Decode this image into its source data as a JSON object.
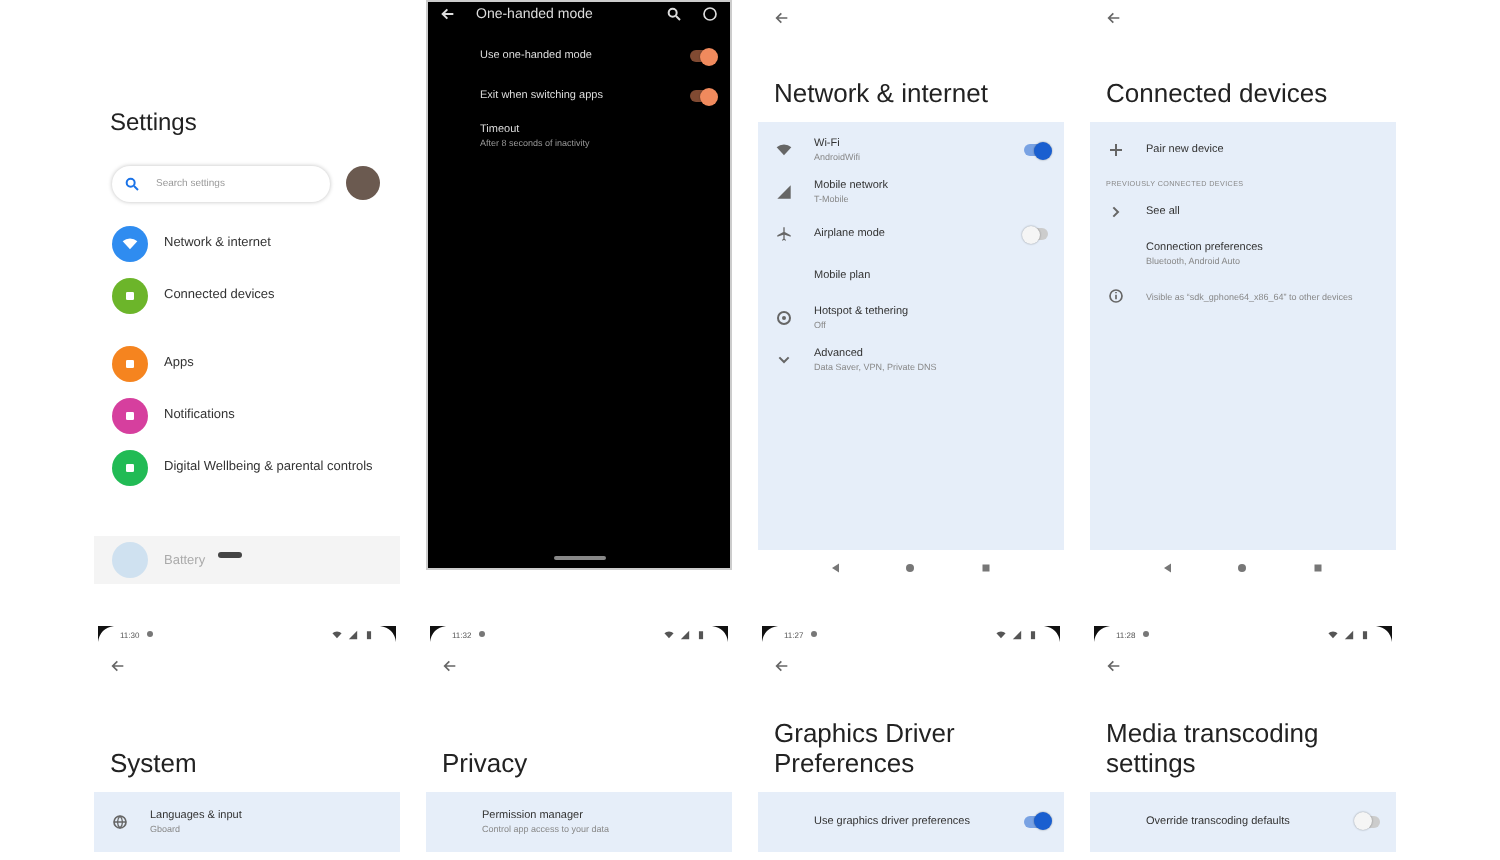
{
  "screens": [
    {
      "kind": "home",
      "title": "Settings",
      "search": {
        "placeholder": "Search settings"
      },
      "groups": [
        [
          {
            "label": "Network & internet",
            "color": "#2f8cf0"
          },
          {
            "label": "Connected devices",
            "color": "#6cb52a"
          }
        ],
        [
          {
            "label": "Apps",
            "color": "#f5841f"
          },
          {
            "label": "Notifications",
            "color": "#d63f9e"
          },
          {
            "label": "Digital Wellbeing & parental controls",
            "color": "#22bb55"
          }
        ]
      ],
      "peek": {
        "label": "Battery",
        "color": "#cfe1f0"
      }
    },
    {
      "kind": "dark",
      "title": "One-handed mode",
      "rows": [
        {
          "kind": "switch",
          "label": "Use one-handed mode",
          "on": true
        },
        {
          "kind": "switch",
          "label": "Exit when switching apps",
          "on": true
        },
        {
          "kind": "text",
          "label": "Timeout",
          "summary": "After 8 seconds of inactivity"
        }
      ]
    },
    {
      "kind": "list",
      "title": "Network & internet",
      "rows": [
        {
          "kind": "switch",
          "label": "Wi-Fi",
          "summary": "AndroidWifi",
          "on": true
        },
        {
          "kind": "text",
          "label": "Mobile network",
          "summary": "T-Mobile"
        },
        {
          "kind": "switch",
          "label": "Airplane mode",
          "on": false
        },
        {
          "kind": "text",
          "label": "Mobile plan"
        },
        {
          "kind": "text",
          "label": "Hotspot & tethering",
          "summary": "Off"
        },
        {
          "kind": "text",
          "label": "Advanced",
          "summary": "Data Saver, VPN, Private DNS"
        }
      ]
    },
    {
      "kind": "list",
      "title": "Connected devices",
      "rows": [
        {
          "kind": "text",
          "label": "Pair new device"
        },
        {
          "kind": "header",
          "label": "PREVIOUSLY CONNECTED DEVICES"
        },
        {
          "kind": "text",
          "label": "See all"
        },
        {
          "kind": "text",
          "label": "Connection preferences",
          "summary": "Bluetooth, Android Auto"
        },
        {
          "kind": "info",
          "label": "Visible as “sdk_gphone64_x86_64” to other devices"
        }
      ]
    },
    {
      "kind": "list",
      "time": "11:30",
      "title": "System",
      "rows": [
        {
          "kind": "text",
          "label": "Languages & input",
          "summary": "Gboard"
        }
      ]
    },
    {
      "kind": "list",
      "time": "11:32",
      "title": "Privacy",
      "rows": [
        {
          "kind": "text",
          "label": "Permission manager",
          "summary": "Control app access to your data"
        }
      ]
    },
    {
      "kind": "list",
      "time": "11:27",
      "title": "Graphics Driver Preferences",
      "rows": [
        {
          "kind": "switch",
          "label": "Use graphics driver preferences",
          "on": true
        }
      ]
    },
    {
      "kind": "list",
      "time": "11:28",
      "title": "Media transcoding settings",
      "rows": [
        {
          "kind": "switch",
          "label": "Override transcoding defaults",
          "on": false
        }
      ]
    }
  ]
}
